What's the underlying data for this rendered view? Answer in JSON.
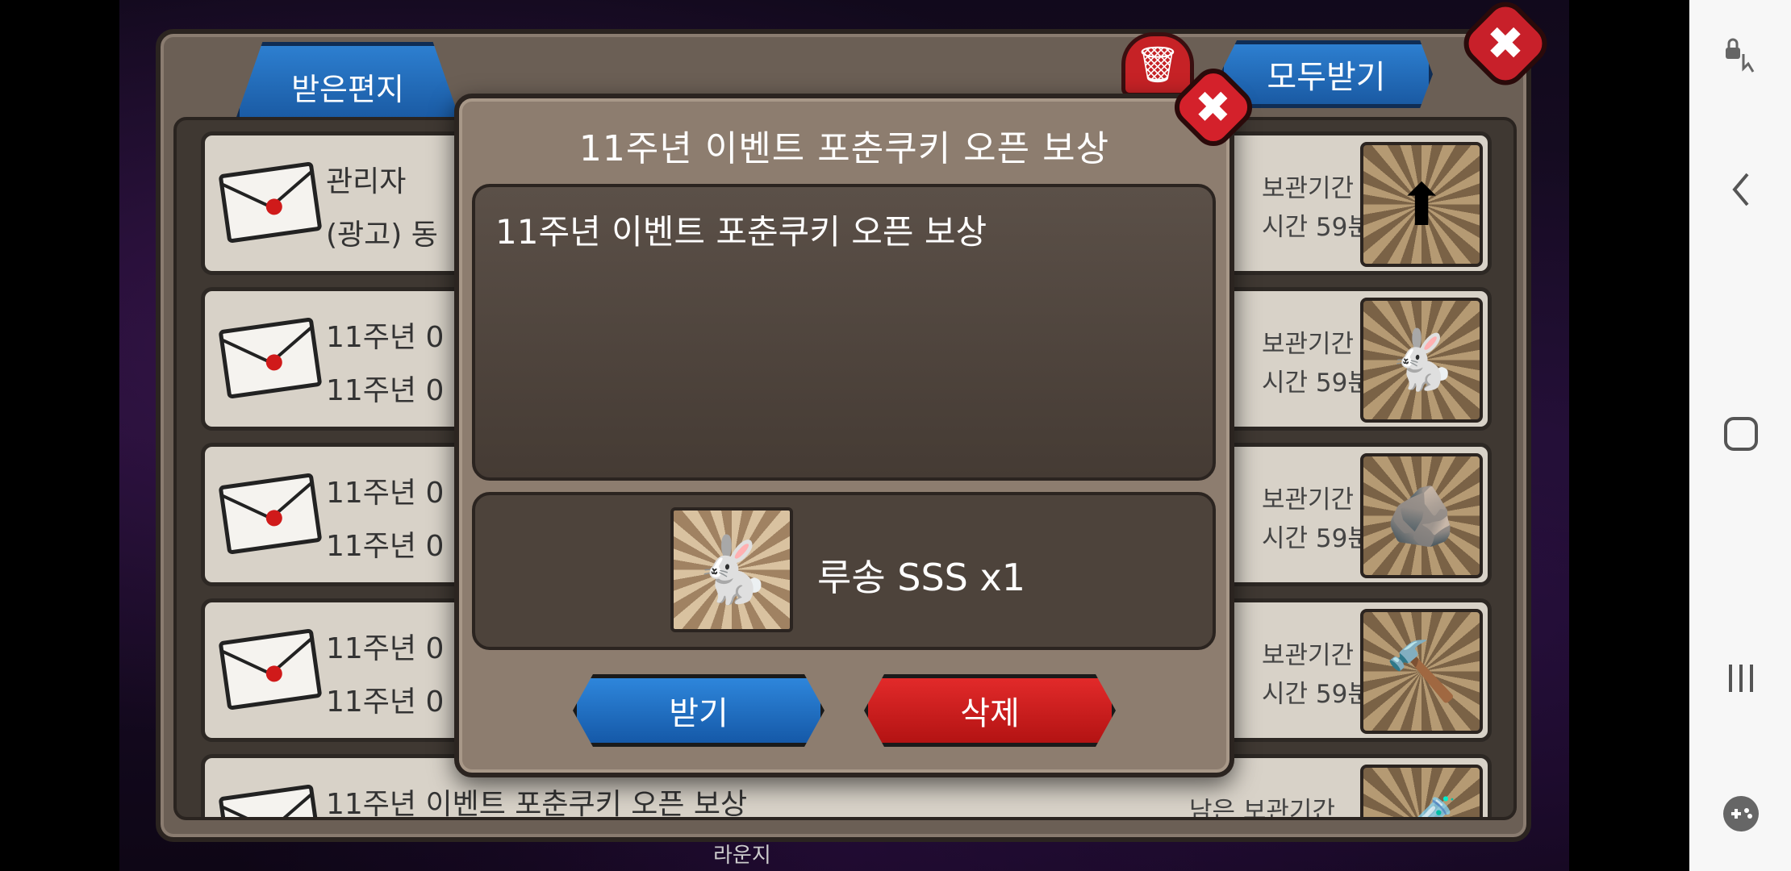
{
  "mailbox": {
    "tab_received": "받은편지",
    "receive_all": "모두받기",
    "trash_icon": "trash-icon",
    "close_icon": "close-icon",
    "rows": [
      {
        "sender": "관리자",
        "subject": "(광고) 동",
        "expire_label": "보관기간",
        "expire_time": "시간 59분",
        "thumb": "level-up-premium-icon"
      },
      {
        "sender": "11주년 0",
        "subject": "11주년 0",
        "expire_label": "보관기간",
        "expire_time": "시간 59분",
        "thumb": "lusong-pet-icon"
      },
      {
        "sender": "11주년 0",
        "subject": "11주년 0",
        "expire_label": "보관기간",
        "expire_time": "시간 59분",
        "thumb": "rock-creature-icon"
      },
      {
        "sender": "11주년 0",
        "subject": "11주년 0",
        "expire_label": "보관기간",
        "expire_time": "시간 59분",
        "thumb": "hammer-weapon-icon"
      },
      {
        "sender": "11주년 이벤트 포춘쿠키 오픈 보상",
        "subject": "",
        "expire_label": "남은 보관기간",
        "expire_time": "",
        "thumb": "potion-bottle-icon"
      }
    ]
  },
  "modal": {
    "title": "11주년 이벤트 포춘쿠키 오픈 보상",
    "body": "11주년 이벤트 포춘쿠키 오픈 보상",
    "reward_label": "루송 SSS x1",
    "reward_icon": "lusong-pet-icon",
    "receive_button": "받기",
    "delete_button": "삭제"
  },
  "background": {
    "bottom_label": "라운지"
  },
  "navbar": {
    "icons": [
      "touch-lock-icon",
      "back-icon",
      "home-icon",
      "recents-icon",
      "game-tools-icon"
    ]
  }
}
